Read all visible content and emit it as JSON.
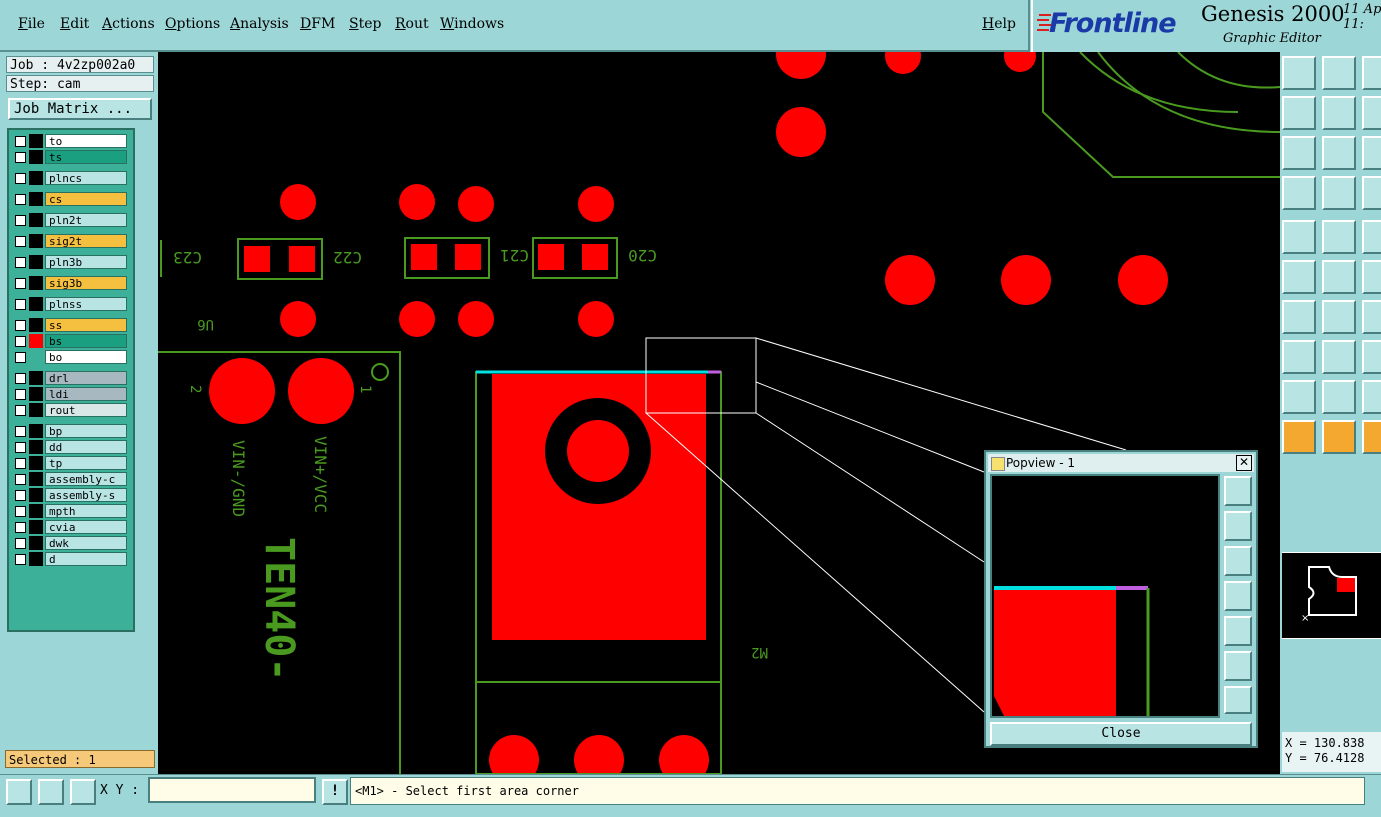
{
  "menu": {
    "items": [
      "File",
      "Edit",
      "Actions",
      "Options",
      "Analysis",
      "DFM",
      "Step",
      "Rout",
      "Windows"
    ],
    "help": "Help"
  },
  "brand": {
    "logo": "Frontline",
    "product": "Genesis 2000",
    "subtitle": "Graphic Editor",
    "date_line1": "11 Ap",
    "date_line2": "11:"
  },
  "job": {
    "job_line": "Job : 4v2zp002a0",
    "step_line": "Step: cam",
    "matrix_button": "Job Matrix ..."
  },
  "layers": [
    {
      "name": "to",
      "color": "#ffffff"
    },
    {
      "name": "ts",
      "color": "#1aa080"
    },
    {
      "name": "plncs",
      "color": "#b8e4e4"
    },
    {
      "name": "cs",
      "color": "#f5c040"
    },
    {
      "name": "pln2t",
      "color": "#b8e4e4"
    },
    {
      "name": "sig2t",
      "color": "#f5c040"
    },
    {
      "name": "pln3b",
      "color": "#b8e4e4"
    },
    {
      "name": "sig3b",
      "color": "#f5c040"
    },
    {
      "name": "plnss",
      "color": "#b8e4e4"
    },
    {
      "name": "ss",
      "color": "#f5c040"
    },
    {
      "name": "bs",
      "color": "#1aa080"
    },
    {
      "name": "bo",
      "color": "#ffffff"
    },
    {
      "name": "drl",
      "color": "#a8b8c0"
    },
    {
      "name": "ldi",
      "color": "#a8b8c0"
    },
    {
      "name": "rout",
      "color": "#d8e8e8"
    },
    {
      "name": "bp",
      "color": "#b8e4e4"
    },
    {
      "name": "dd",
      "color": "#b8e4e4"
    },
    {
      "name": "tp",
      "color": "#b8e4e4"
    },
    {
      "name": "assembly-c",
      "color": "#b8e4e4"
    },
    {
      "name": "assembly-s",
      "color": "#b8e4e4"
    },
    {
      "name": "mpth",
      "color": "#b8e4e4"
    },
    {
      "name": "cvia",
      "color": "#b8e4e4"
    },
    {
      "name": "dwk",
      "color": "#b8e4e4"
    },
    {
      "name": "d",
      "color": "#b8e4e4"
    }
  ],
  "selected_text": "Selected : 1",
  "coords": {
    "x": "X = 130.838",
    "y": "Y = 76.4128"
  },
  "bottom": {
    "xy_label": "X Y :",
    "status": "<M1> - Select first area corner"
  },
  "popview": {
    "title": "Popview - 1",
    "close_label": "Close",
    "close_x": "✕"
  },
  "board_labels": {
    "c23": "C23",
    "c22": "C22",
    "c21": "C21",
    "c20": "C20",
    "u6": "U6",
    "m2": "M2",
    "pin2": "2",
    "pin1": "1",
    "vin_gnd": "VIN-/GND",
    "vin_vcc": "VIN+/VCC",
    "part": "TEN40-"
  },
  "colors": {
    "copper": "#ff0000",
    "silk": "#4a9a20",
    "accent": "#9cd6d6"
  }
}
